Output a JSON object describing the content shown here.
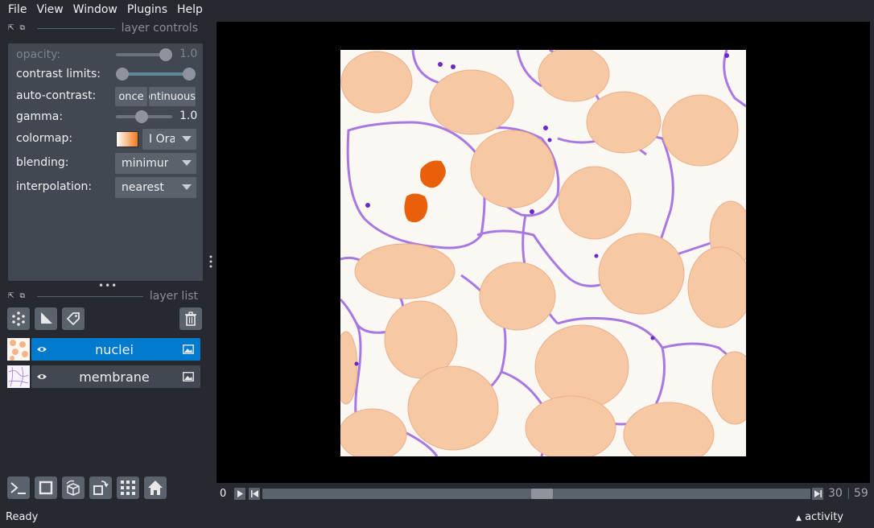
{
  "menu": [
    "File",
    "View",
    "Window",
    "Plugins",
    "Help"
  ],
  "layer_controls": {
    "title": "layer controls",
    "opacity_label": "opacity:",
    "opacity_value": "1.0",
    "contrast_label": "contrast limits:",
    "auto_contrast_label": "auto-contrast:",
    "once_button": "once",
    "continuous_button": "continuous",
    "gamma_label": "gamma:",
    "gamma_value": "1.0",
    "colormap_label": "colormap:",
    "colormap_value": "I Orange",
    "blending_label": "blending:",
    "blending_value": "minimum",
    "interpolation_label": "interpolation:",
    "interpolation_value": "nearest"
  },
  "layer_list": {
    "title": "layer list",
    "layers": [
      {
        "name": "nuclei",
        "selected": true
      },
      {
        "name": "membrane",
        "selected": false
      }
    ]
  },
  "dims": {
    "start": "0",
    "current": "30",
    "max": "59",
    "position_fraction": 0.51
  },
  "status": {
    "text": "Ready",
    "activity": "activity"
  },
  "colors": {
    "accent": "#007acc",
    "background": "#262930",
    "panel": "#414851",
    "control": "#5a626c",
    "nuclei": "#f08a4b",
    "membrane": "#8a3ee0"
  }
}
